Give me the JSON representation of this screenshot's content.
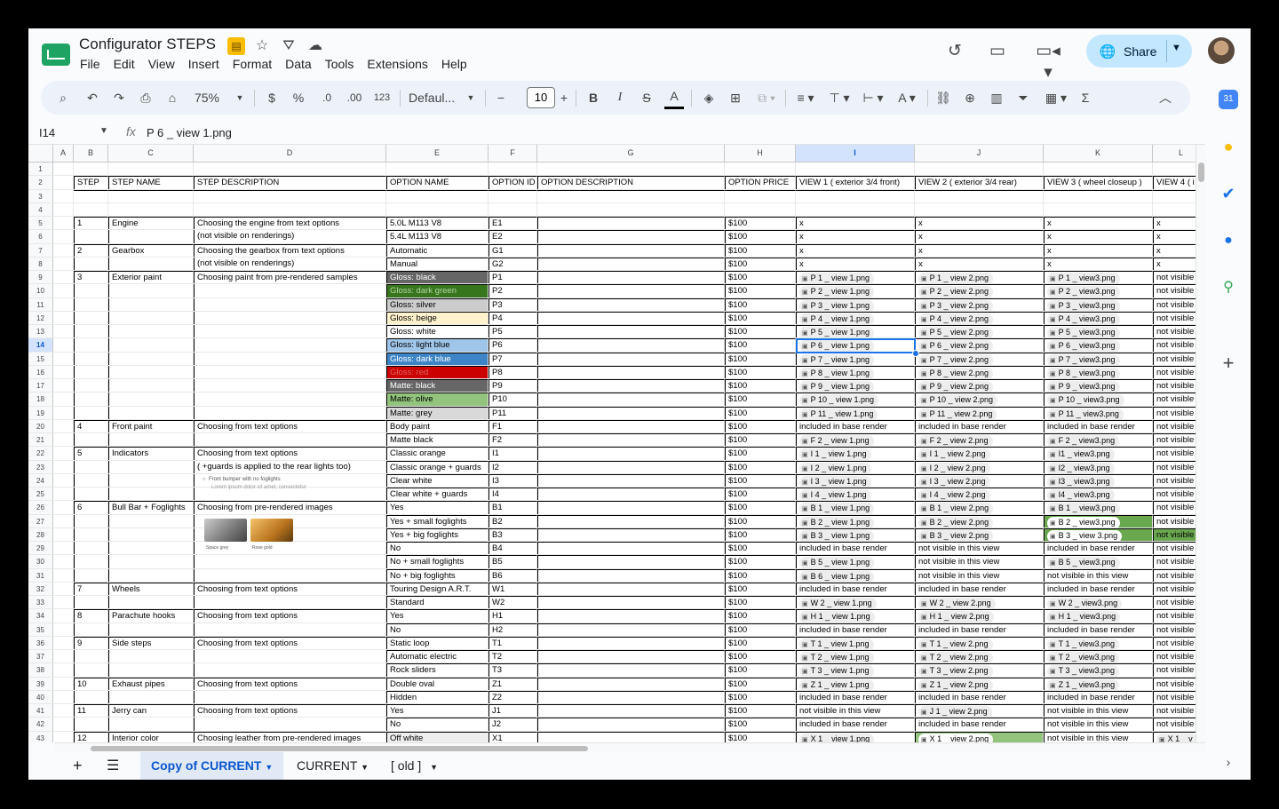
{
  "app": {
    "title": "Configurator STEPS",
    "menu": [
      "File",
      "Edit",
      "View",
      "Insert",
      "Format",
      "Data",
      "Tools",
      "Extensions",
      "Help"
    ],
    "share_label": "Share"
  },
  "toolbar": {
    "zoom": "75%",
    "currency": "$",
    "percent": "%",
    "dec_decrease": ".0",
    "dec_increase": ".00",
    "number_format": "123",
    "font": "Defaul...",
    "font_size": "10",
    "bold": "B",
    "italic": "I",
    "strike": "S",
    "text_color": "A"
  },
  "formula_bar": {
    "name_box": "I14",
    "fx": "fx",
    "formula": "P 6 _ view 1.png"
  },
  "columns": [
    "A",
    "B",
    "C",
    "D",
    "E",
    "F",
    "G",
    "H",
    "I",
    "J",
    "K",
    "L"
  ],
  "rows": [
    [
      "",
      "",
      "",
      "",
      "",
      "",
      "",
      "",
      "",
      "",
      ""
    ],
    [
      "STEP",
      "STEP NAME",
      "STEP DESCRIPTION",
      "OPTION NAME",
      "OPTION ID",
      "OPTION DESCRIPTION",
      "OPTION PRICE",
      "VIEW 1 ( exterior 3/4 front)",
      "VIEW 2 ( exterior 3/4 rear)",
      "VIEW 3 ( wheel closeup )",
      "VIEW 4 ( i"
    ],
    [
      "",
      "",
      "",
      "",
      "",
      "",
      "",
      "",
      "",
      "",
      ""
    ],
    [
      "",
      "",
      "",
      "",
      "",
      "",
      "",
      "",
      "",
      "",
      ""
    ],
    [
      "1",
      "Engine",
      "Choosing the engine from text options",
      "5.0L M113 V8",
      "E1",
      "",
      "$100",
      "x",
      "x",
      "x",
      "x"
    ],
    [
      "",
      "",
      "(not visible on renderings)",
      "5.4L M113 V8",
      "E2",
      "",
      "$100",
      "x",
      "x",
      "x",
      "x"
    ],
    [
      "2",
      "Gearbox",
      "Choosing the gearbox from text options",
      "Automatic",
      "G1",
      "",
      "$100",
      "x",
      "x",
      "x",
      "x"
    ],
    [
      "",
      "",
      "(not visible on renderings)",
      "Manual",
      "G2",
      "",
      "$100",
      "x",
      "x",
      "x",
      "x"
    ],
    [
      "3",
      "Exterior paint",
      "Choosing paint from pre-rendered samples",
      "Gloss: black",
      "P1",
      "",
      "$100",
      "P 1 _ view 1.png",
      "P 1 _ view 2.png",
      "P 1 _ view3.png",
      "not visible"
    ],
    [
      "",
      "",
      "",
      "Gloss: dark green",
      "P2",
      "",
      "$100",
      "P 2 _ view 1.png",
      "P 2 _ view 2.png",
      "P 2 _ view3.png",
      "not visible"
    ],
    [
      "",
      "",
      "",
      "Gloss: silver",
      "P3",
      "",
      "$100",
      "P 3 _ view 1.png",
      "P 3 _ view 2.png",
      "P 3 _ view3.png",
      "not visible"
    ],
    [
      "",
      "",
      "",
      "Gloss: beige",
      "P4",
      "",
      "$100",
      "P 4 _ view 1.png",
      "P 4 _ view 2.png",
      "P 4 _ view3.png",
      "not visible"
    ],
    [
      "",
      "",
      "",
      "Gloss: white",
      "P5",
      "",
      "$100",
      "P 5 _ view 1.png",
      "P 5 _ view 2.png",
      "P 5 _ view3.png",
      "not visible"
    ],
    [
      "",
      "",
      "",
      "Gloss: light blue",
      "P6",
      "",
      "$100",
      "P 6 _ view 1.png",
      "P 6 _ view 2.png",
      "P 6 _ view3.png",
      "not visible"
    ],
    [
      "",
      "",
      "",
      "Gloss: dark blue",
      "P7",
      "",
      "$100",
      "P 7 _ view 1.png",
      "P 7 _ view 2.png",
      "P 7 _ view3.png",
      "not visible"
    ],
    [
      "",
      "",
      "",
      "Gloss: red",
      "P8",
      "",
      "$100",
      "P 8 _ view 1.png",
      "P 8 _ view 2.png",
      "P 8 _ view3.png",
      "not visible"
    ],
    [
      "",
      "",
      "",
      "Matte: black",
      "P9",
      "",
      "$100",
      "P 9 _ view 1.png",
      "P 9 _ view 2.png",
      "P 9 _ view3.png",
      "not visible"
    ],
    [
      "",
      "",
      "",
      "Matte: olive",
      "P10",
      "",
      "$100",
      "P 10 _ view 1.png",
      "P 10 _ view 2.png",
      "P 10 _ view3.png",
      "not visible"
    ],
    [
      "",
      "",
      "",
      "Matte: grey",
      "P11",
      "",
      "$100",
      "P 11 _ view 1.png",
      "P 11 _ view 2.png",
      "P 11 _ view3.png",
      "not visible"
    ],
    [
      "4",
      "Front paint",
      "Choosing from text options",
      "Body paint",
      "F1",
      "",
      "$100",
      "included in base render",
      "included in base render",
      "included in base render",
      "not visible"
    ],
    [
      "",
      "",
      "",
      "Matte black",
      "F2",
      "",
      "$100",
      "F 2 _ view 1.png",
      "F 2 _ view 2.png",
      "F 2 _ view3.png",
      "not visible"
    ],
    [
      "5",
      "Indicators",
      "Choosing from text options",
      "Classic orange",
      "I1",
      "",
      "$100",
      "I 1 _ view 1.png",
      "I 1 _ view 2.png",
      "I1 _ view3.png",
      "not visible"
    ],
    [
      "",
      "",
      "( +guards is applied to the rear lights too)",
      "Classic orange + guards",
      "I2",
      "",
      "$100",
      "I 2 _ view 1.png",
      "I 2 _ view 2.png",
      "I2 _ view3.png",
      "not visible"
    ],
    [
      "",
      "",
      "",
      "Clear white",
      "I3",
      "",
      "$100",
      "I 3 _ view 1.png",
      "I 3 _ view 2.png",
      "I3 _ view3.png",
      "not visible"
    ],
    [
      "",
      "",
      "",
      "Clear white + guards",
      "I4",
      "",
      "$100",
      "I 4 _ view 1.png",
      "I 4 _ view 2.png",
      "I4 _ view3.png",
      "not visible"
    ],
    [
      "6",
      "Bull Bar + Foglights",
      "Choosing from pre-rendered images",
      "Yes",
      "B1",
      "",
      "$100",
      "B 1 _ view 1.png",
      "B 1 _ view 2.png",
      "B 1 _ view3.png",
      "not visible"
    ],
    [
      "",
      "",
      "",
      "Yes + small foglights",
      "B2",
      "",
      "$100",
      "B 2 _ view 1.png",
      "B 2 _ view 2.png",
      "B 2 _ view3.png",
      "not visible"
    ],
    [
      "",
      "",
      "",
      "Yes + big foglights",
      "B3",
      "",
      "$100",
      "B 3 _ view 1.png",
      "B 3 _ view 2.png",
      "B 3 _ view 3.png",
      "not visible"
    ],
    [
      "",
      "",
      "",
      "No",
      "B4",
      "",
      "$100",
      "included in base render",
      "not visible in this view",
      "included in base render",
      "not visible"
    ],
    [
      "",
      "",
      "",
      "No + small foglights",
      "B5",
      "",
      "$100",
      "B 5 _ view 1.png",
      "not visible in this view",
      "B 5 _ view3.png",
      "not visible"
    ],
    [
      "",
      "",
      "",
      "No + big foglights",
      "B6",
      "",
      "$100",
      "B 6 _ view 1.png",
      "not visible in this view",
      "not visible in this view",
      "not visible"
    ],
    [
      "7",
      "Wheels",
      "Choosing from text options",
      "Touring Design A.R.T.",
      "W1",
      "",
      "$100",
      "included in base render",
      "included in base render",
      "included in base render",
      "not visible"
    ],
    [
      "",
      "",
      "",
      "Standard",
      "W2",
      "",
      "$100",
      "W 2 _ view 1.png",
      "W 2 _ view 2.png",
      "W 2 _ view3.png",
      "not visible"
    ],
    [
      "8",
      "Parachute hooks",
      "Choosing from text options",
      "Yes",
      "H1",
      "",
      "$100",
      "H 1 _ view 1.png",
      "H 1 _ view 2.png",
      "H 1 _ view3.png",
      "not visible"
    ],
    [
      "",
      "",
      "",
      "No",
      "H2",
      "",
      "$100",
      "included in base render",
      "included in base render",
      "included in base render",
      "not visible"
    ],
    [
      "9",
      "Side steps",
      "Choosing from text options",
      "Static loop",
      "T1",
      "",
      "$100",
      "T 1 _ view 1.png",
      "T 1 _ view 2.png",
      "T 1 _ view3.png",
      "not visible"
    ],
    [
      "",
      "",
      "",
      "Automatic electric",
      "T2",
      "",
      "$100",
      "T 2 _ view 1.png",
      "T 2 _ view 2.png",
      "T 2 _ view3.png",
      "not visible"
    ],
    [
      "",
      "",
      "",
      "Rock sliders",
      "T3",
      "",
      "$100",
      "T 3 _ view 1.png",
      "T 3 _ view 2.png",
      "T 3 _ view3.png",
      "not visible"
    ],
    [
      "10",
      "Exhaust pipes",
      "Choosing from text options",
      "Double oval",
      "Z1",
      "",
      "$100",
      "Z 1 _ view 1.png",
      "Z 1 _ view 2.png",
      "Z 1 _ view3.png",
      "not visible"
    ],
    [
      "",
      "",
      "",
      "Hidden",
      "Z2",
      "",
      "$100",
      "included in base render",
      "included in base render",
      "included in base render",
      "not visible"
    ],
    [
      "11",
      "Jerry can",
      "Choosing from text options",
      "Yes",
      "J1",
      "",
      "$100",
      "not visible in this view",
      "J 1 _ view 2.png",
      "not visible in this view",
      "not visible"
    ],
    [
      "",
      "",
      "",
      "No",
      "J2",
      "",
      "$100",
      "included in base render",
      "included in base render",
      "not visible in this view",
      "not visible"
    ],
    [
      "12",
      "Interior color",
      "Choosing leather from pre-rendered images",
      "Off white",
      "X1",
      "",
      "$100",
      "X 1 _ view 1.png",
      "X 1 _ view 2.png",
      "not visible in this view",
      "X 1 _ v"
    ]
  ],
  "swatches": {
    "9": "#666666",
    "10": "#38761d",
    "11": "#cccccc",
    "12": "#fff2cc",
    "13": "#ffffff",
    "14": "#9fc5e8",
    "15": "#3d85c6",
    "16": "#cc0000",
    "17": "#666666",
    "18": "#93c47d",
    "19": "#d9d9d9",
    "43": "#eeeeee"
  },
  "highlights": {
    "27": {
      "col": 9,
      "color": "#6aa84f"
    },
    "28": {
      "col": 9,
      "color": "#6aa84f"
    },
    "28k": {
      "col": 10,
      "color": "#6aa84f"
    },
    "43": {
      "col": 8,
      "color": "#93c47d"
    }
  },
  "selected_cell": "I14",
  "notes": {
    "indicator_image_caption": "Front bumper with no foglights",
    "indicator_image_sub": "Lorem ipsum dolor sit amet, consectetur",
    "bullbar_img1": "Space grey",
    "bullbar_img2": "Rose gold"
  },
  "sheets": [
    "Copy of CURRENT",
    "CURRENT",
    "[ old ]"
  ]
}
